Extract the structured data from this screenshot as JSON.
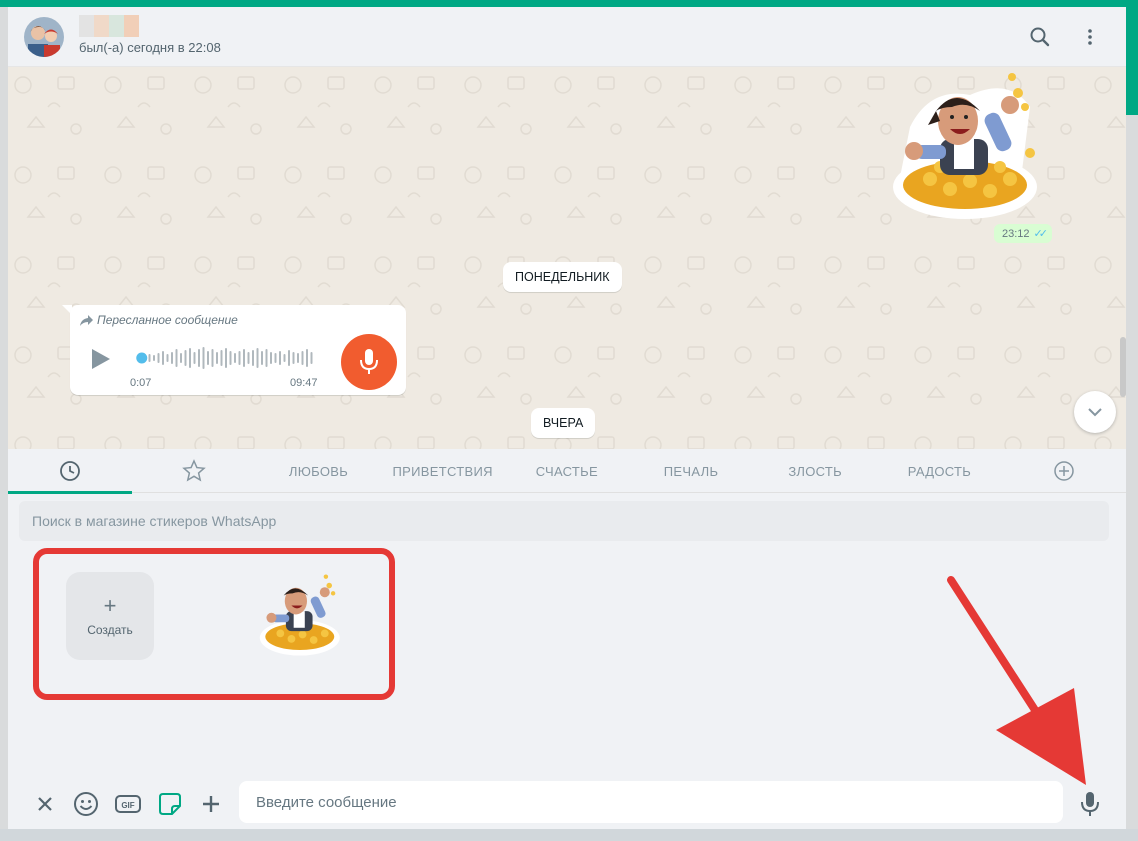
{
  "header": {
    "last_seen": "был(-а) сегодня в 22:08",
    "name_blur_colors": [
      "#e3e3e3",
      "#f0d9c8",
      "#d8e6dd",
      "#f1cfb8"
    ]
  },
  "chat": {
    "sent_time": "23:12",
    "day_monday": "ПОНЕДЕЛЬНИК",
    "day_yesterday": "ВЧЕРА",
    "voice": {
      "forwarded_label": "Пересланное сообщение",
      "current_time": "0:07",
      "duration": "09:47",
      "progress": 0.01
    }
  },
  "sticker_panel": {
    "tabs": [
      {
        "icon": "clock-icon",
        "label": ""
      },
      {
        "icon": "star-icon",
        "label": ""
      },
      {
        "label": "ЛЮБОВЬ"
      },
      {
        "label": "ПРИВЕТСТВИЯ"
      },
      {
        "label": "СЧАСТЬЕ"
      },
      {
        "label": "ПЕЧАЛЬ"
      },
      {
        "label": "ЗЛОСТЬ"
      },
      {
        "label": "РАДОСТЬ"
      },
      {
        "icon": "plus-circle-icon",
        "label": ""
      }
    ],
    "active_tab": 0,
    "search_placeholder": "Поиск в магазине стикеров WhatsApp",
    "create_label": "Создать",
    "create_symbol": "+"
  },
  "compose": {
    "placeholder": "Введите сообщение",
    "icons": [
      "close-icon",
      "emoji-icon",
      "gif-icon",
      "sticker-icon",
      "attach-plus-icon",
      "mic-icon"
    ],
    "gif_label": "GIF"
  },
  "colors": {
    "accent": "#00a884",
    "highlight": "#e53935",
    "mic_button": "#f15c2f",
    "read_ticks": "#53bdeb"
  }
}
